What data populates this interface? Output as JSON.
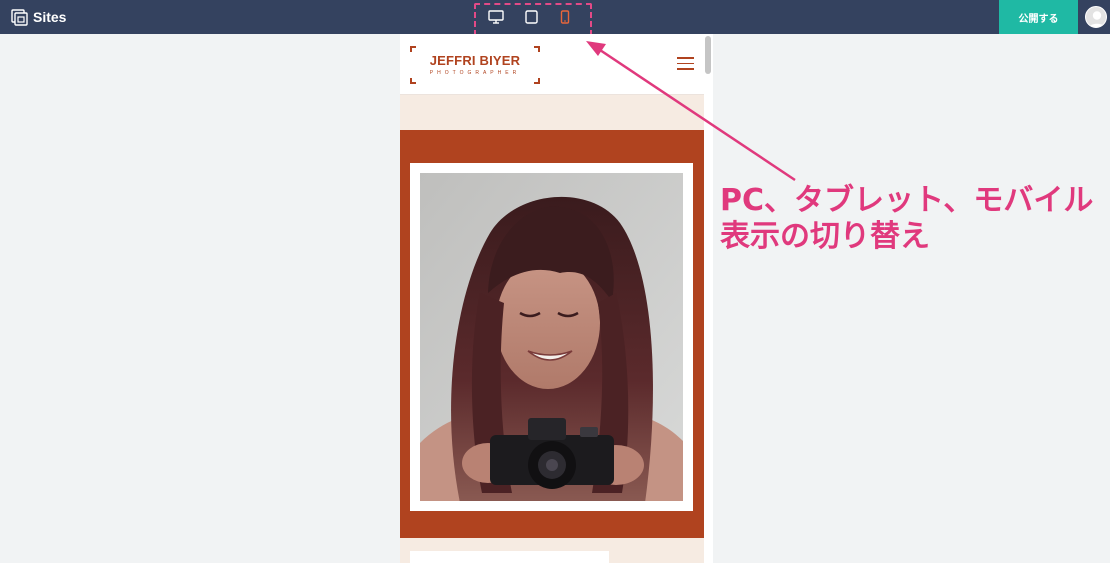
{
  "app": {
    "title": "Sites",
    "icon": "sites-logo-icon"
  },
  "device_toggle": {
    "desktop": {
      "icon": "desktop-icon",
      "active": false
    },
    "tablet": {
      "icon": "tablet-icon",
      "active": false
    },
    "mobile": {
      "icon": "mobile-icon",
      "active": true,
      "active_color": "#e8663b"
    }
  },
  "toolbar": {
    "publish_label": "公開する",
    "publish_color": "#1fb9a4",
    "avatar_icon": "account-avatar-icon"
  },
  "preview": {
    "logo_name": "JEFFRI BIYER",
    "logo_subtitle": "PHOTOGRAPHER",
    "menu_icon": "hamburger-menu-icon",
    "accent_color": "#b0431f",
    "background_color": "#f6ebe2",
    "hero_image": "woman-with-camera-photo"
  },
  "annotation": {
    "line1": "PC、タブレット、モバイル",
    "line2": "表示の切り替え",
    "color": "#e0397d"
  }
}
